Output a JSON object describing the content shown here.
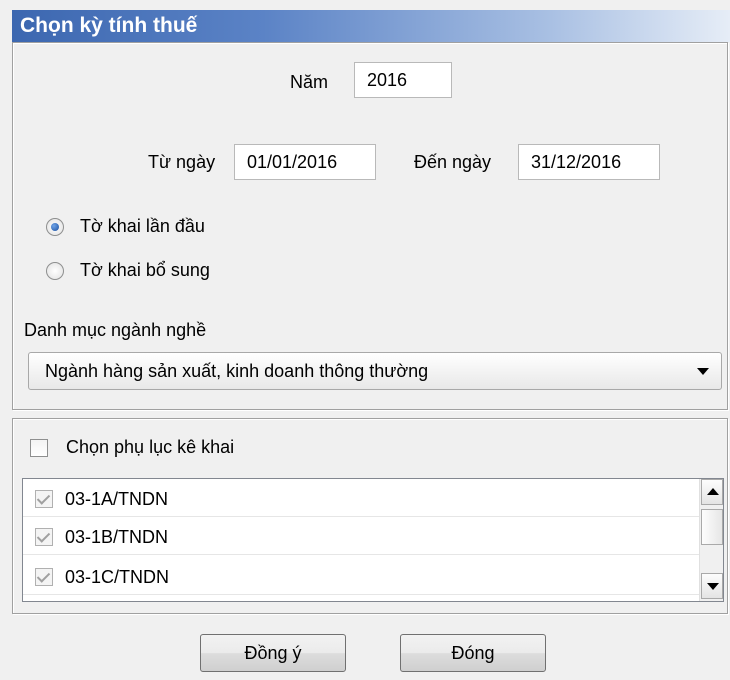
{
  "window": {
    "title": "Chọn kỳ tính thuế"
  },
  "year": {
    "label": "Năm",
    "value": "2016"
  },
  "period": {
    "from_label": "Từ ngày",
    "from_value": "01/01/2016",
    "to_label": "Đến ngày",
    "to_value": "31/12/2016"
  },
  "declaration_type": {
    "options": [
      {
        "label": "Tờ khai lần đầu",
        "selected": true
      },
      {
        "label": "Tờ khai bổ sung",
        "selected": false
      }
    ]
  },
  "industry": {
    "label": "Danh mục ngành nghề",
    "selected": "Ngành hàng sản xuất, kinh doanh thông thường"
  },
  "appendix": {
    "toggle_label": "Chọn phụ lục kê khai",
    "toggle_checked": false,
    "items": [
      {
        "label": "03-1A/TNDN",
        "checked": true
      },
      {
        "label": "03-1B/TNDN",
        "checked": true
      },
      {
        "label": "03-1C/TNDN",
        "checked": true
      }
    ]
  },
  "buttons": {
    "ok": "Đồng ý",
    "close": "Đóng"
  }
}
